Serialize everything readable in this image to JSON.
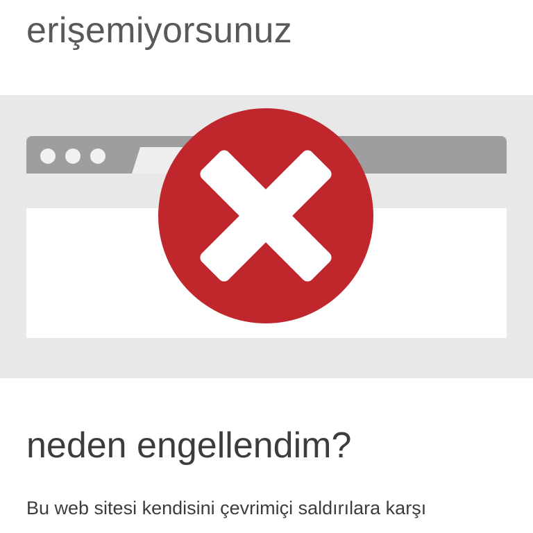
{
  "header": {
    "title_tail": "erişemiyorsunuz"
  },
  "illustration": {
    "icon": "error-x-circle-icon",
    "colors": {
      "band": "#e8e8e8",
      "toolbar": "#9e9e9e",
      "content": "#ffffff",
      "error_circle": "#c0272d",
      "error_cross": "#ffffff"
    }
  },
  "section": {
    "heading": "neden engellendim?",
    "body_line_1": "Bu web sitesi kendisini çevrimiçi saldırılara karşı"
  }
}
